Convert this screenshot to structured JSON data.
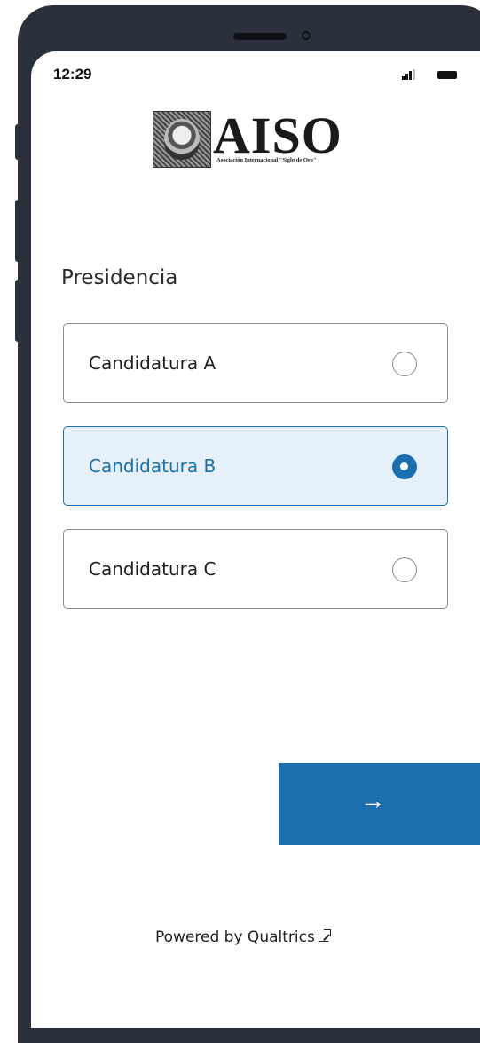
{
  "status_bar": {
    "time": "12:29",
    "signal_icon": "cellular-signal-icon",
    "battery_icon": "battery-icon"
  },
  "logo": {
    "title": "AISO",
    "subtitle": "Asociación Internacional \"Siglo de Oro\""
  },
  "question": {
    "title": "Presidencia",
    "selected_index": 1,
    "options": [
      {
        "label": "Candidatura A",
        "selected": false
      },
      {
        "label": "Candidatura B",
        "selected": true
      },
      {
        "label": "Candidatura C",
        "selected": false
      }
    ]
  },
  "navigation": {
    "next_label": "→"
  },
  "footer": {
    "text": "Powered by Qualtrics",
    "icon": "external-link-icon"
  },
  "colors": {
    "accent": "#1a6fae",
    "selected_background": "#e5f0f8",
    "device_frame": "#2b313a"
  }
}
